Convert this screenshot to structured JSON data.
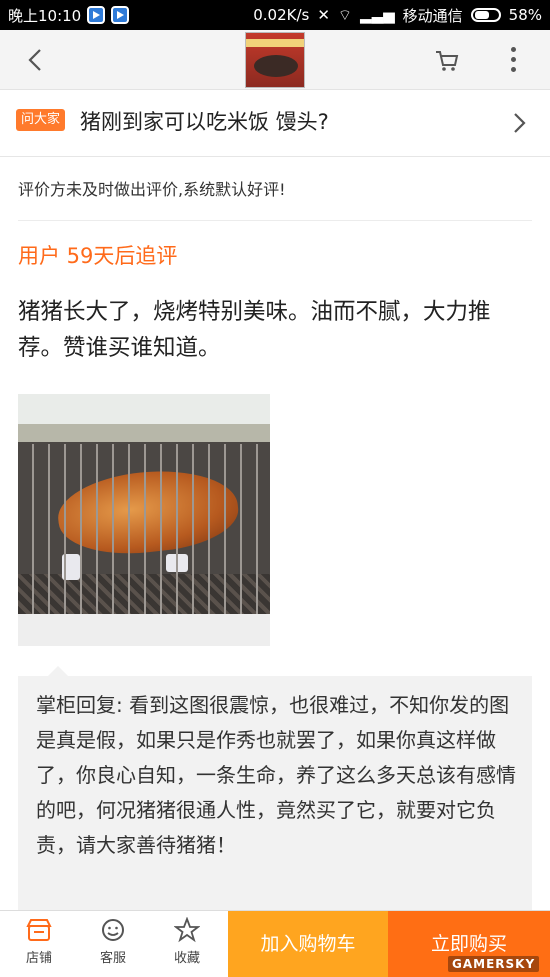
{
  "status_bar": {
    "time": "晚上10:10",
    "network_speed": "0.02K/s",
    "carrier": "移动通信",
    "battery": "58%"
  },
  "question": {
    "badge": "问大家",
    "text": "猪刚到家可以吃米饭 馒头?"
  },
  "review": {
    "note": "评价方未及时做出评价,系统默认好评!",
    "user_line": "用户 59天后追评",
    "comment": "猪猪长大了，烧烤特别美味。油而不腻，大力推荐。赞谁买谁知道。"
  },
  "reply": {
    "text": "掌柜回复: 看到这图很震惊，也很难过，不知你发的图是真是假，如果只是作秀也就罢了，如果你真这样做了，你良心自知，一条生命，养了这么多天总该有感情的吧，何况猪猪很通人性，竟然买了它，就要对它负责，请大家善待猪猪！"
  },
  "bottom_bar": {
    "shop_label": "店铺",
    "service_label": "客服",
    "favorite_label": "收藏",
    "add_cart_label": "加入购物车",
    "buy_now_label": "立即购买"
  },
  "watermark": "GAMERSKY",
  "colors": {
    "accent_orange": "#ff6a1a",
    "add_cart_bg": "#ffa51f",
    "buy_now_bg": "#ff6e14"
  },
  "icons": {
    "back": "chevron-left-icon",
    "cart": "cart-icon",
    "more": "more-vertical-icon",
    "question_arrow": "chevron-right-icon",
    "shop": "shop-icon",
    "service": "service-icon",
    "favorite": "star-icon"
  }
}
